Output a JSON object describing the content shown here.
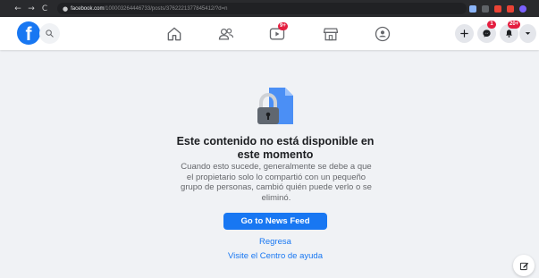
{
  "browser": {
    "nav_back": "←",
    "nav_forward": "→",
    "nav_reload": "C",
    "url_host": "facebook.com",
    "url_path": "/100003264446733/posts/3762221377845412/?d=n"
  },
  "header": {
    "logo_text": "f",
    "watch_badge": "9+",
    "messenger_badge": "1",
    "notifications_badge": "20+"
  },
  "content": {
    "title": "Este contenido no está disponible en este momento",
    "description": "Cuando esto sucede, generalmente se debe a que el propietario solo lo compartió con un pequeño grupo de personas, cambió quién puede verlo o se eliminó.",
    "primary_button": "Go to News Feed",
    "link_back": "Regresa",
    "link_help": "Visite el Centro de ayuda"
  },
  "colors": {
    "brand": "#1877f2",
    "badge": "#e41e3f",
    "background": "#f0f2f5"
  },
  "icons": [
    "lock-document-icon",
    "search-icon",
    "home-icon",
    "friends-icon",
    "watch-icon",
    "marketplace-icon",
    "groups-icon",
    "plus-icon",
    "messenger-icon",
    "bell-icon",
    "caret-down-icon",
    "compose-icon"
  ]
}
